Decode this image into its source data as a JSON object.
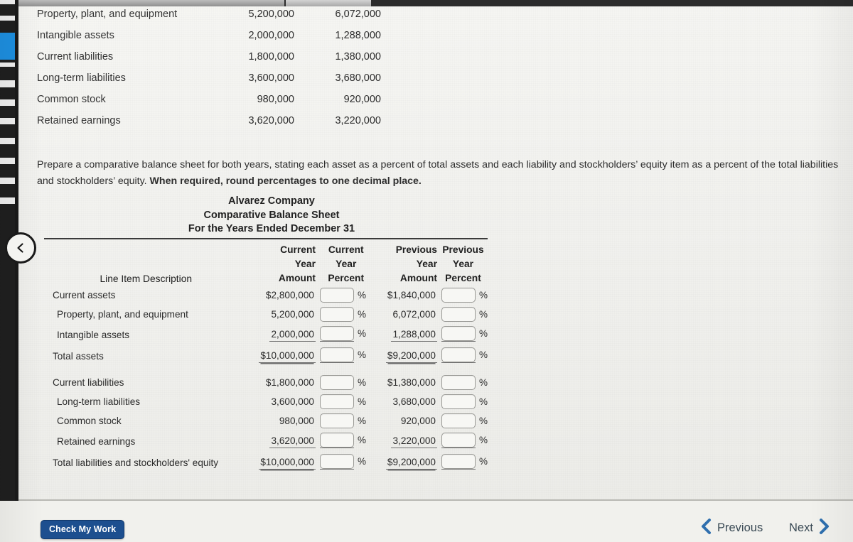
{
  "browser": {
    "back_button_icon": "chevron-left-icon"
  },
  "top_table": {
    "rows": [
      {
        "label": "Property, plant, and equipment",
        "current": "5,200,000",
        "previous": "6,072,000"
      },
      {
        "label": "Intangible assets",
        "current": "2,000,000",
        "previous": "1,288,000"
      },
      {
        "label": "Current liabilities",
        "current": "1,800,000",
        "previous": "1,380,000"
      },
      {
        "label": "Long-term liabilities",
        "current": "3,600,000",
        "previous": "3,680,000"
      },
      {
        "label": "Common stock",
        "current": "980,000",
        "previous": "920,000"
      },
      {
        "label": "Retained earnings",
        "current": "3,620,000",
        "previous": "3,220,000"
      }
    ]
  },
  "instructions": {
    "normal": "Prepare a comparative balance sheet for both years, stating each asset as a percent of total assets and each liability and stockholders’ equity item as a percent of the total liabilities and stockholders’ equity. ",
    "bold": "When required, round percentages to one decimal place."
  },
  "statement": {
    "company": "Alvarez Company",
    "title": "Comparative Balance Sheet",
    "period": "For the Years Ended December 31"
  },
  "worksheet": {
    "headers": {
      "label": "Line Item Description",
      "current_amount": [
        "Current",
        "Year",
        "Amount"
      ],
      "current_percent": [
        "Current",
        "Year",
        "Percent"
      ],
      "previous_amount": [
        "Previous",
        "Year",
        "Amount"
      ],
      "previous_percent": [
        "Previous",
        "Year",
        "Percent"
      ]
    },
    "percent_sign": "%",
    "input_value": "",
    "rows": [
      {
        "label": "Current assets",
        "indent": false,
        "cur_amt": "$2,800,000",
        "cur_pct": "",
        "prev_amt": "$1,840,000",
        "prev_pct": "",
        "rule": "none",
        "space_after": false
      },
      {
        "label": "Property, plant, and equipment",
        "indent": true,
        "cur_amt": "5,200,000",
        "cur_pct": "",
        "prev_amt": "6,072,000",
        "prev_pct": "",
        "rule": "none",
        "space_after": false
      },
      {
        "label": "Intangible assets",
        "indent": true,
        "cur_amt": "2,000,000",
        "cur_pct": "",
        "prev_amt": "1,288,000",
        "prev_pct": "",
        "rule": "single",
        "space_after": false
      },
      {
        "label": "Total assets",
        "indent": false,
        "cur_amt": "$10,000,000",
        "cur_pct": "",
        "prev_amt": "$9,200,000",
        "prev_pct": "",
        "rule": "double",
        "space_after": true
      },
      {
        "label": "Current liabilities",
        "indent": false,
        "cur_amt": "$1,800,000",
        "cur_pct": "",
        "prev_amt": "$1,380,000",
        "prev_pct": "",
        "rule": "none",
        "space_after": false
      },
      {
        "label": "Long-term liabilities",
        "indent": true,
        "cur_amt": "3,600,000",
        "cur_pct": "",
        "prev_amt": "3,680,000",
        "prev_pct": "",
        "rule": "none",
        "space_after": false
      },
      {
        "label": "Common stock",
        "indent": true,
        "cur_amt": "980,000",
        "cur_pct": "",
        "prev_amt": "920,000",
        "prev_pct": "",
        "rule": "none",
        "space_after": false
      },
      {
        "label": "Retained earnings",
        "indent": true,
        "cur_amt": "3,620,000",
        "cur_pct": "",
        "prev_amt": "3,220,000",
        "prev_pct": "",
        "rule": "single",
        "space_after": false
      },
      {
        "label": "Total liabilities and stockholders' equity",
        "indent": false,
        "cur_amt": "$10,000,000",
        "cur_pct": "",
        "prev_amt": "$9,200,000",
        "prev_pct": "",
        "rule": "double",
        "space_after": false
      }
    ]
  },
  "footer": {
    "check_my_work": "Check My Work",
    "previous": "Previous",
    "next": "Next",
    "previous_icon": "chevron-left-icon",
    "next_icon": "chevron-right-icon"
  },
  "colors": {
    "page_background": "#f2f2ef",
    "button_blue": "#1d4f8f",
    "chevron_blue": "#2f6fae",
    "tab_accent": "#1d8fe0",
    "rule_dark": "#3a3a3a",
    "rule_gray": "#6d6d6d"
  }
}
